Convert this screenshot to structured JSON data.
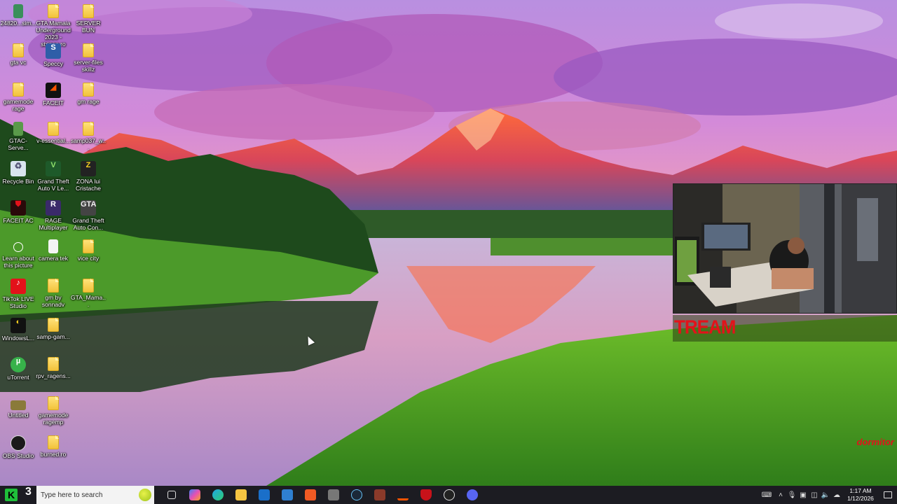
{
  "desktop": {
    "icons": [
      {
        "label": "24820...sim...",
        "icon": "sim-card-icon"
      },
      {
        "label": "GTA Mamaia Underground 2023 - stringe.ro",
        "icon": "folder-icon"
      },
      {
        "label": "SERVER BUN",
        "icon": "folder-icon"
      },
      {
        "label": "gta vc",
        "icon": "folder-icon"
      },
      {
        "label": "Speccy",
        "icon": "speccy-icon"
      },
      {
        "label": "server-files skillz",
        "icon": "folder-icon"
      },
      {
        "label": "gamemode rage",
        "icon": "folder-icon"
      },
      {
        "label": "FACEIT",
        "icon": "faceit-icon"
      },
      {
        "label": "gm rage",
        "icon": "folder-icon"
      },
      {
        "label": "GTAC-Serve...",
        "icon": "gtac-icon"
      },
      {
        "label": "v-essential...",
        "icon": "folder-icon"
      },
      {
        "label": "samp037_w...",
        "icon": "samp-icon"
      },
      {
        "label": "Recycle Bin",
        "icon": "recycle-bin-icon"
      },
      {
        "label": "Grand Theft Auto V Le...",
        "icon": "gta-v-icon"
      },
      {
        "label": "ZONA lui Cristache",
        "icon": "zona-icon"
      },
      {
        "label": "FACEIT AC",
        "icon": "faceit-ac-icon"
      },
      {
        "label": "RAGE Multiplayer",
        "icon": "rage-mp-icon"
      },
      {
        "label": "Grand Theft Auto Con...",
        "icon": "gta-con-icon"
      },
      {
        "label": "Learn about this picture",
        "icon": "learn-picture-icon"
      },
      {
        "label": "camera tek",
        "icon": "document-icon"
      },
      {
        "label": "vice city",
        "icon": "folder-icon"
      },
      {
        "label": "TikTok LIVE Studio",
        "icon": "tiktok-live-icon"
      },
      {
        "label": "gm by sonnadv",
        "icon": "folder-icon"
      },
      {
        "label": "GTA_Mama...",
        "icon": "folder-icon"
      },
      {
        "label": "WindowsL...",
        "icon": "windows-loader-icon"
      },
      {
        "label": "samp-gam...",
        "icon": "folder-icon"
      },
      {
        "label": "uTorrent",
        "icon": "utorrent-icon"
      },
      {
        "label": "rpv_ragens...",
        "icon": "folder-icon"
      },
      {
        "label": "Untitled",
        "icon": "untitled-icon"
      },
      {
        "label": "gamemode ragemp",
        "icon": "folder-icon"
      },
      {
        "label": "OBS Studio",
        "icon": "obs-icon"
      },
      {
        "label": "burned.ro",
        "icon": "folder-icon"
      }
    ]
  },
  "overlay": {
    "stream_text": "TREAM",
    "corner_text": "dormitor"
  },
  "taskbar": {
    "start_badge": "3",
    "search_placeholder": "Type here to search",
    "pinned": [
      "task-view-icon",
      "copilot-icon",
      "edge-icon",
      "file-explorer-icon",
      "outlook-icon",
      "store-icon",
      "brave-icon",
      "gta-iv-icon",
      "steam-icon",
      "game-icon",
      "faceit-icon",
      "shield-icon",
      "obs-icon",
      "discord-icon"
    ],
    "clock_time": "1:17 AM",
    "clock_date": "1/12/2026"
  },
  "colors": {
    "taskbar_bg": "#1c1c22",
    "stream_red": "#e3121a",
    "folder_yellow": "#f2c23a"
  }
}
